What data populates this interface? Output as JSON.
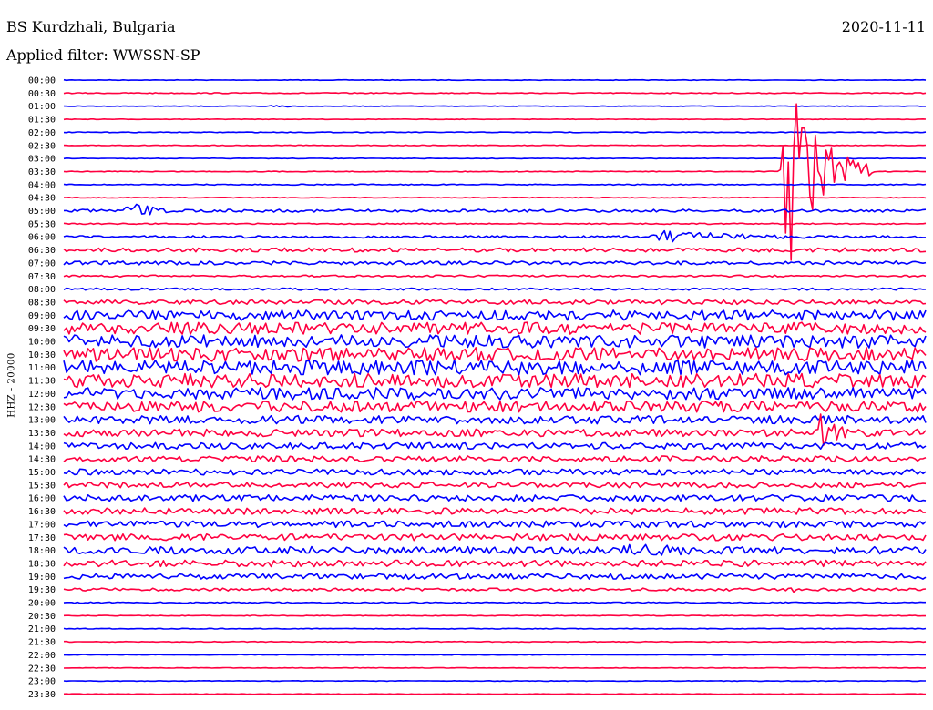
{
  "header": {
    "station": "BS Kurdzhali, Bulgaria",
    "filter": "Applied filter: WWSSN-SP",
    "date": "2020-11-11",
    "channel": "HHZ - 20000"
  },
  "colors": {
    "trace_a": "#0000ff",
    "trace_b": "#ff0040"
  },
  "chart_data": {
    "type": "line",
    "title": "BS Kurdzhali, Bulgaria",
    "subtitle": "Applied filter: WWSSN-SP",
    "date": "2020-11-11",
    "ylabel": "HHZ - 20000",
    "y_tick_labels": [
      "00:00",
      "00:30",
      "01:00",
      "01:30",
      "02:00",
      "02:30",
      "03:00",
      "03:30",
      "04:00",
      "04:30",
      "05:00",
      "05:30",
      "06:00",
      "06:30",
      "07:00",
      "07:30",
      "08:00",
      "08:30",
      "09:00",
      "09:30",
      "10:00",
      "10:30",
      "11:00",
      "11:30",
      "12:00",
      "12:30",
      "13:00",
      "13:30",
      "14:00",
      "14:30",
      "15:00",
      "15:30",
      "16:00",
      "16:30",
      "17:00",
      "17:30",
      "18:00",
      "18:30",
      "19:00",
      "19:30",
      "20:00",
      "20:30",
      "21:00",
      "21:30",
      "22:00",
      "22:30",
      "23:00",
      "23:30"
    ],
    "trace_colors_alternating": [
      "#0000ff",
      "#ff0040"
    ],
    "trace_amplitude_profile": [
      0.3,
      0.5,
      0.3,
      0.3,
      0.4,
      0.4,
      0.3,
      0.4,
      0.5,
      0.4,
      1.5,
      0.6,
      1.2,
      2.2,
      2.0,
      1.0,
      1.2,
      2.5,
      5.5,
      6.5,
      7.0,
      7.5,
      8.0,
      7.5,
      6.5,
      6.0,
      4.5,
      4.0,
      3.5,
      3.2,
      3.2,
      3.0,
      3.5,
      3.5,
      3.5,
      3.5,
      4.0,
      3.5,
      3.0,
      1.5,
      0.6,
      0.4,
      0.4,
      0.4,
      0.3,
      0.3,
      0.3,
      0.3
    ],
    "events": [
      {
        "trace": "01:00",
        "from": 0.24,
        "to": 0.27,
        "amp": 7
      },
      {
        "trace": "05:00",
        "from": 0.07,
        "to": 0.15,
        "amp": 14
      },
      {
        "trace": "06:00",
        "from": 0.67,
        "to": 1.0,
        "amp": 9
      },
      {
        "trace": "03:30",
        "from": 0.83,
        "to": 0.94,
        "amp": 150
      },
      {
        "trace": "13:30",
        "from": 0.87,
        "to": 0.94,
        "amp": 30
      },
      {
        "trace": "18:00",
        "from": 0.63,
        "to": 1.0,
        "amp": 10
      },
      {
        "trace": "19:30",
        "from": 0.84,
        "to": 0.87,
        "amp": 12
      }
    ]
  }
}
